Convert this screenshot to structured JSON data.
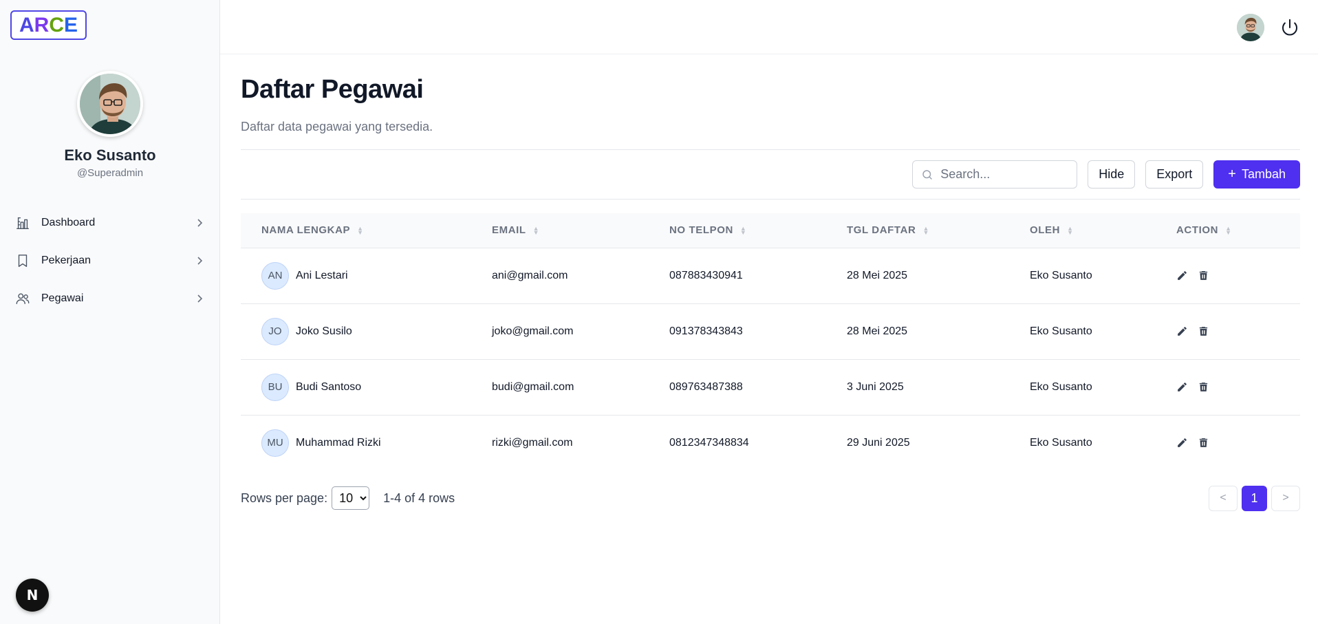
{
  "brand": {
    "letters": [
      {
        "char": "A",
        "color": "#4f46e5"
      },
      {
        "char": "R",
        "color": "#7c3aed"
      },
      {
        "char": "C",
        "color": "#65a30d"
      },
      {
        "char": "E",
        "color": "#2563eb"
      }
    ]
  },
  "user": {
    "name": "Eko Susanto",
    "handle": "@Superadmin"
  },
  "sidebar": {
    "items": [
      {
        "label": "Dashboard",
        "icon": "chart-bar-icon"
      },
      {
        "label": "Pekerjaan",
        "icon": "bookmark-icon"
      },
      {
        "label": "Pegawai",
        "icon": "users-icon"
      }
    ]
  },
  "page": {
    "title": "Daftar Pegawai",
    "subtitle": "Daftar data pegawai yang tersedia."
  },
  "toolbar": {
    "search_placeholder": "Search...",
    "hide_label": "Hide",
    "export_label": "Export",
    "add_label": "Tambah"
  },
  "table": {
    "columns": [
      "NAMA LENGKAP",
      "EMAIL",
      "NO TELPON",
      "TGL DAFTAR",
      "OLEH",
      "ACTION"
    ],
    "rows": [
      {
        "initials": "AN",
        "name": "Ani Lestari",
        "email": "ani@gmail.com",
        "phone": "087883430941",
        "date": "28 Mei 2025",
        "by": "Eko Susanto"
      },
      {
        "initials": "JO",
        "name": "Joko Susilo",
        "email": "joko@gmail.com",
        "phone": "091378343843",
        "date": "28 Mei 2025",
        "by": "Eko Susanto"
      },
      {
        "initials": "BU",
        "name": "Budi Santoso",
        "email": "budi@gmail.com",
        "phone": "089763487388",
        "date": "3 Juni 2025",
        "by": "Eko Susanto"
      },
      {
        "initials": "MU",
        "name": "Muhammad Rizki",
        "email": "rizki@gmail.com",
        "phone": "0812347348834",
        "date": "29 Juni 2025",
        "by": "Eko Susanto"
      }
    ]
  },
  "pagination": {
    "rows_label": "Rows per page:",
    "rows_value": "10",
    "range": "1-4 of 4 rows",
    "prev": "<",
    "current": "1",
    "next": ">"
  },
  "badge": {
    "letter": "N"
  }
}
